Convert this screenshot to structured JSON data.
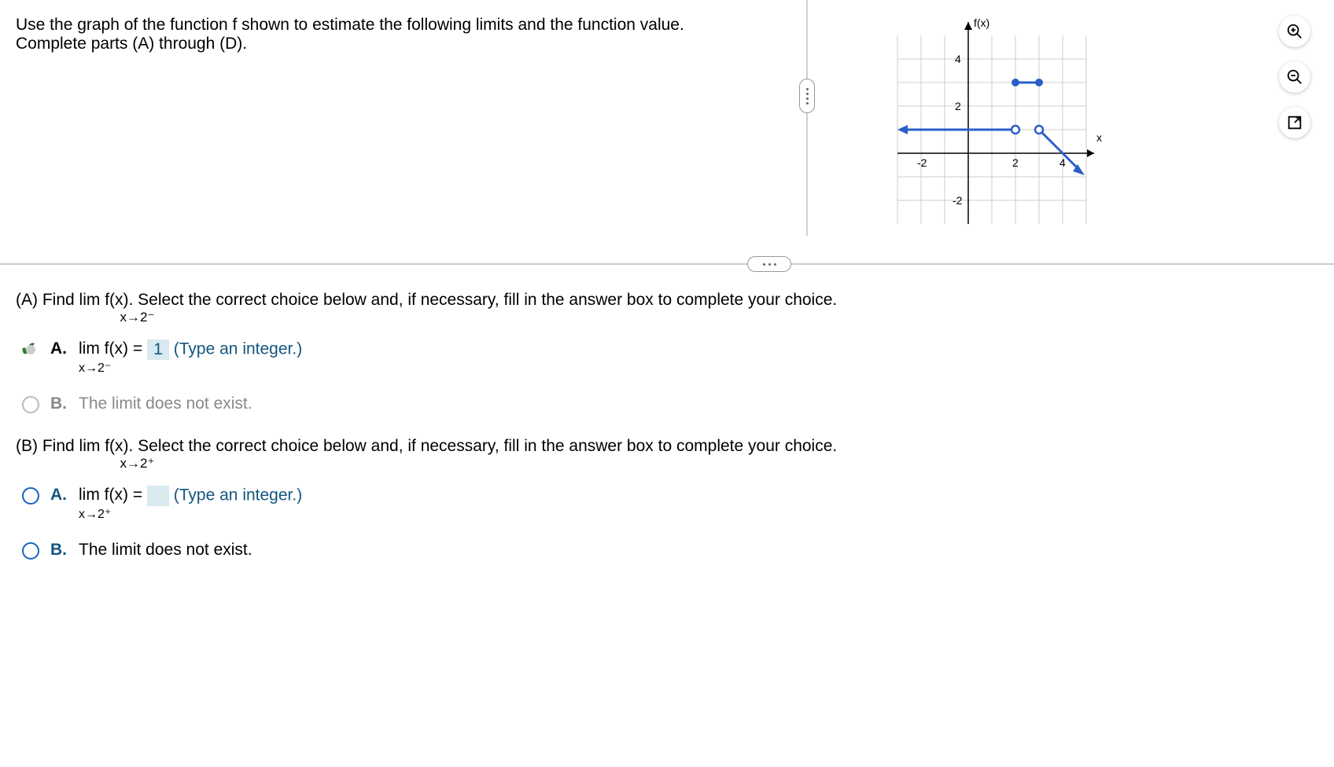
{
  "question": {
    "line1": "Use the graph of the function f shown to estimate the following limits and the function value.",
    "line2": "Complete parts (A) through (D)."
  },
  "graph": {
    "y_label": "f(x)",
    "x_label": "x",
    "y_ticks": [
      "4",
      "2",
      "-2"
    ],
    "x_ticks": [
      "-2",
      "2",
      "4"
    ]
  },
  "partA": {
    "prompt_prefix": "(A) Find",
    "prompt_lim": "lim f(x). Select the correct choice below and, if necessary, fill in the answer box to complete your choice.",
    "prompt_sub": "x→2⁻",
    "optionA": {
      "label": "A.",
      "lim_text": "lim f(x) =",
      "lim_sub": "x→2⁻",
      "value": "1",
      "hint": "(Type an integer.)"
    },
    "optionB": {
      "label": "B.",
      "text": "The limit does not exist."
    }
  },
  "partB": {
    "prompt_prefix": "(B) Find",
    "prompt_lim": "lim f(x). Select the correct choice below and, if necessary, fill in the answer box to complete your choice.",
    "prompt_sub": "x→2⁺",
    "optionA": {
      "label": "A.",
      "lim_text": "lim f(x) =",
      "lim_sub": "x→2⁺",
      "value": "",
      "hint": "(Type an integer.)"
    },
    "optionB": {
      "label": "B.",
      "text": "The limit does not exist."
    }
  },
  "chart_data": {
    "type": "line",
    "title": "",
    "xlabel": "x",
    "ylabel": "f(x)",
    "xlim": [
      -3,
      5
    ],
    "ylim": [
      -3,
      5
    ],
    "segments": [
      {
        "from": [
          -3,
          1
        ],
        "to": [
          2,
          1
        ],
        "style": "arrow-left",
        "end": "open"
      },
      {
        "from": [
          2,
          3
        ],
        "to": [
          3,
          3
        ],
        "style": "solid-closed-both"
      },
      {
        "from": [
          3,
          3
        ],
        "to": [
          5,
          -1
        ],
        "style": "arrow-right",
        "start_open_at": [
          3,
          1
        ]
      }
    ],
    "points": [
      {
        "x": 2,
        "y": 1,
        "type": "open"
      },
      {
        "x": 2,
        "y": 3,
        "type": "closed"
      },
      {
        "x": 3,
        "y": 3,
        "type": "closed"
      },
      {
        "x": 3,
        "y": 1,
        "type": "open"
      }
    ]
  }
}
